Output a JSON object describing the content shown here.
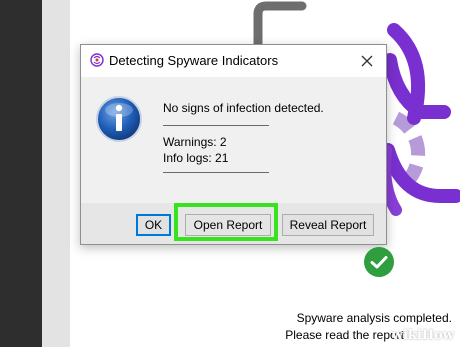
{
  "dialog": {
    "title": "Detecting Spyware Indicators",
    "message": "No signs of infection detected.",
    "warnings": "Warnings: 2",
    "info_logs": "Info logs: 21",
    "buttons": {
      "ok": "OK",
      "open_report": "Open Report",
      "reveal_report": "Reveal Report"
    }
  },
  "status": {
    "line1": "Spyware analysis completed.",
    "line2": "Please read the report"
  },
  "watermark": "wikiHow",
  "colors": {
    "highlight": "#39e21f",
    "accent_purple": "#7a2fd0",
    "success_green": "#2e9e3e",
    "info_blue": "#1f5fb8",
    "dark_strip": "#2e2e2e"
  },
  "icons": {
    "title": "app-logo-icon",
    "close": "close-icon",
    "info": "info-icon",
    "status": "check-icon"
  }
}
